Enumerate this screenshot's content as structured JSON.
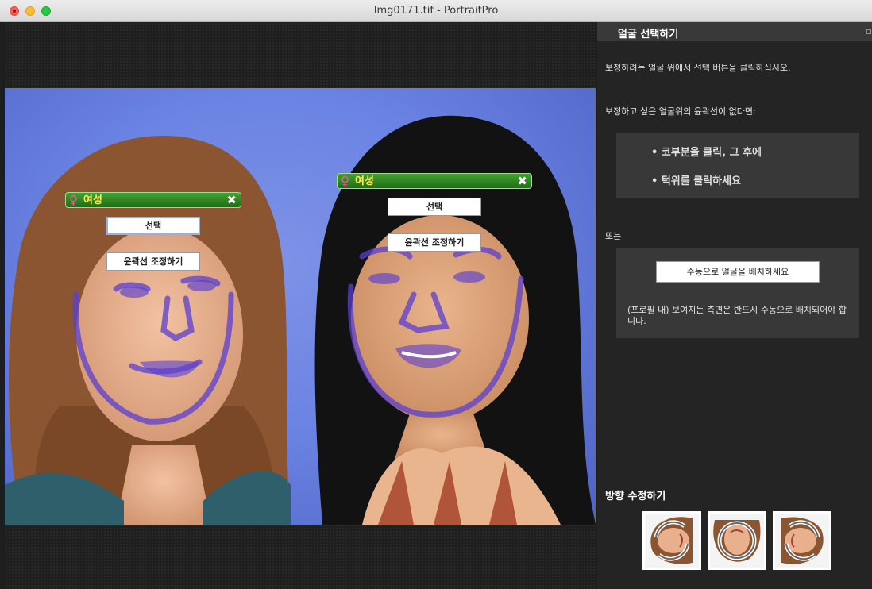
{
  "window": {
    "title": "Img0171.tif - PortraitPro"
  },
  "faces": [
    {
      "gender_symbol": "♀",
      "gender_label": "여성",
      "close_symbol": "✖",
      "select_label": "선택",
      "adjust_label": "윤곽선 조정하기"
    },
    {
      "gender_symbol": "♀",
      "gender_label": "여성",
      "close_symbol": "✖",
      "select_label": "선택",
      "adjust_label": "윤곽선 조정하기"
    }
  ],
  "panel": {
    "title": "얼굴 선택하기",
    "instruction": "보정하려는 얼굴 위에서 선택 버튼을 클릭하십시오.",
    "no_outline_text": "보정하고 싶은 얼굴위의 윤곽선이 없다면:",
    "bullets": [
      "• 코부분을 클릭, 그 후에",
      "• 턱위를 클릭하세요"
    ],
    "or_text": "또는",
    "manual_button": "수동으로 얼굴을 배치하세요",
    "manual_note": "(프로필 내) 보여지는 측면은 반드시 수동으로 배치되어야 합니다.",
    "orientation_title": "방향 수정하기"
  },
  "icons": {
    "close": "close-icon",
    "female": "female-icon",
    "rotate_left": "rotate-left-icon",
    "rotate_180": "rotate-180-icon",
    "rotate_right": "rotate-right-icon"
  },
  "colors": {
    "face_bar": "#2e8a22",
    "gender_symbol": "#ff4fa8",
    "gender_label": "#ffe94f",
    "outline": "#5b3fd0",
    "panel_bg": "#242424"
  }
}
